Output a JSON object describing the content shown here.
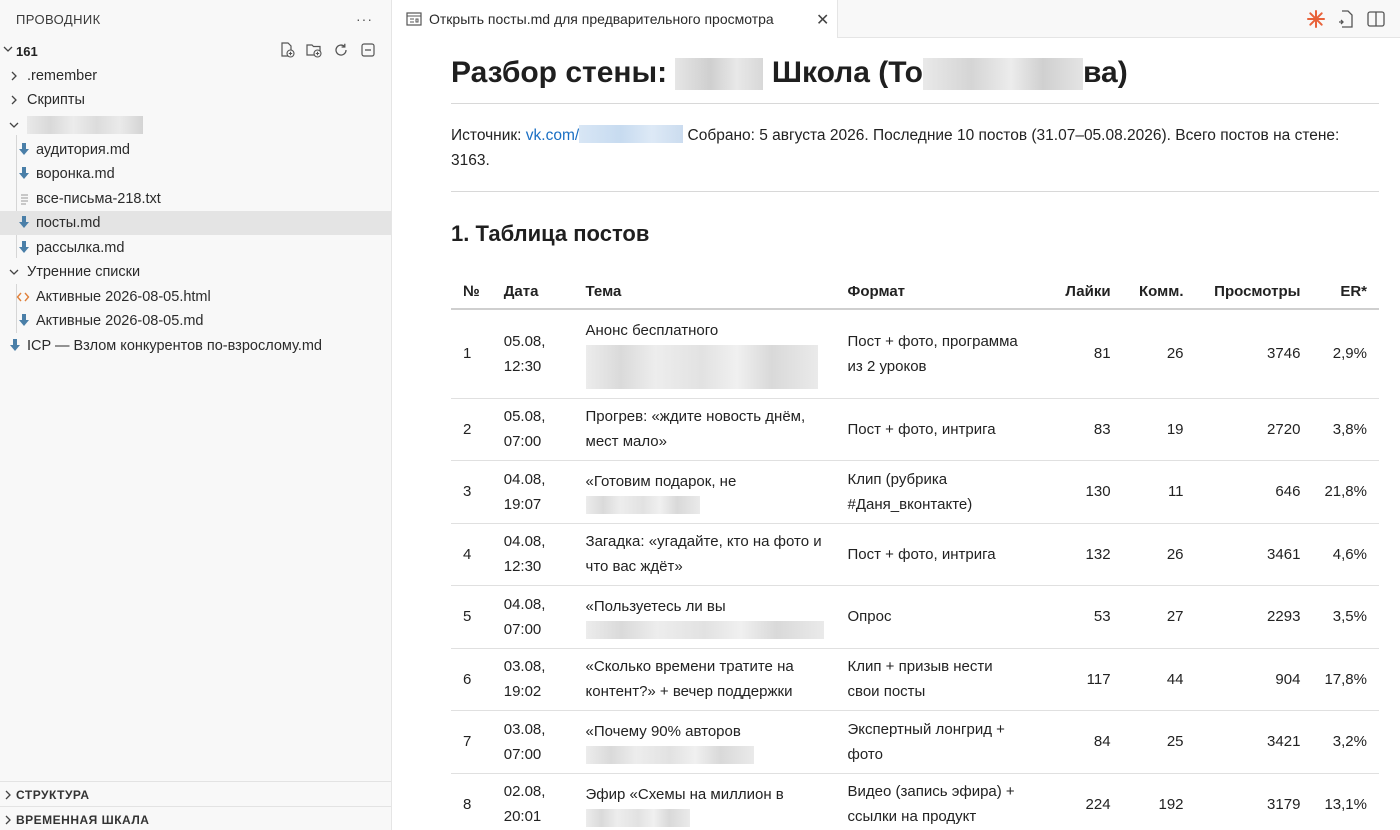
{
  "explorer": {
    "title": "ПРОВОДНИК",
    "more": "···",
    "root_label": "161",
    "items": [
      {
        "label": ".remember",
        "kind": "folder"
      },
      {
        "label": "Скрипты",
        "kind": "folder"
      },
      {
        "label": "",
        "kind": "folder-open"
      },
      {
        "label": "аудитория.md",
        "kind": "md"
      },
      {
        "label": "воронка.md",
        "kind": "md"
      },
      {
        "label": "все-письма-218.txt",
        "kind": "txt"
      },
      {
        "label": "посты.md",
        "kind": "md"
      },
      {
        "label": "рассылка.md",
        "kind": "md"
      },
      {
        "label": "Утренние списки",
        "kind": "folder-open"
      },
      {
        "label": "Активные 2026-08-05.html",
        "kind": "html"
      },
      {
        "label": "Активные 2026-08-05.md",
        "kind": "md"
      },
      {
        "label": "ICP — Взлом конкурентов по-взрослому.md",
        "kind": "md"
      }
    ],
    "structure_label": "СТРУКТУРА",
    "timeline_label": "ВРЕМЕННАЯ ШКАЛА"
  },
  "tab": {
    "label": "Открыть посты.md для предварительного просмотра",
    "close": "✕"
  },
  "accent_color": "#e8623a",
  "doc": {
    "title_part1": "Разбор стены:",
    "title_part2": "Школа (То",
    "title_part3": "ва)",
    "source_prefix": "Источник:",
    "source_link": "vk.com/",
    "source_text": "Собрано: 5 августа 2026. Последние 10 постов (31.07–05.08.2026). Всего постов на стене: 3163.",
    "section_title": "1. Таблица постов"
  },
  "table": {
    "headers": [
      "№",
      "Дата",
      "Тема",
      "Формат",
      "Лайки",
      "Комм.",
      "Просмотры",
      "ER*"
    ],
    "rows": [
      {
        "n": "1",
        "date1": "05.08,",
        "date2": "12:30",
        "topic": "Анонс бесплатного",
        "format": "Пост + фото, программа из 2 уроков",
        "likes": "81",
        "comments": "26",
        "views": "3746",
        "er": "2,9%"
      },
      {
        "n": "2",
        "date1": "05.08,",
        "date2": "07:00",
        "topic": "Прогрев: «ждите новость днём, мест мало»",
        "format": "Пост + фото, интрига",
        "likes": "83",
        "comments": "19",
        "views": "2720",
        "er": "3,8%"
      },
      {
        "n": "3",
        "date1": "04.08,",
        "date2": "19:07",
        "topic": "«Готовим подарок, не",
        "format": "Клип (рубрика #Даня_вконтакте)",
        "likes": "130",
        "comments": "11",
        "views": "646",
        "er": "21,8%"
      },
      {
        "n": "4",
        "date1": "04.08,",
        "date2": "12:30",
        "topic": "Загадка: «угадайте, кто на фото и что вас ждёт»",
        "format": "Пост + фото, интрига",
        "likes": "132",
        "comments": "26",
        "views": "3461",
        "er": "4,6%"
      },
      {
        "n": "5",
        "date1": "04.08,",
        "date2": "07:00",
        "topic": "«Пользуетесь ли вы",
        "format": "Опрос",
        "likes": "53",
        "comments": "27",
        "views": "2293",
        "er": "3,5%"
      },
      {
        "n": "6",
        "date1": "03.08,",
        "date2": "19:02",
        "topic": "«Сколько времени тратите на контент?» + вечер поддержки",
        "format": "Клип + призыв нести свои посты",
        "likes": "117",
        "comments": "44",
        "views": "904",
        "er": "17,8%"
      },
      {
        "n": "7",
        "date1": "03.08,",
        "date2": "07:00",
        "topic": "«Почему 90% авторов",
        "format": "Экспертный лонгрид + фото",
        "likes": "84",
        "comments": "25",
        "views": "3421",
        "er": "3,2%"
      },
      {
        "n": "8",
        "date1": "02.08,",
        "date2": "20:01",
        "topic": "Эфир «Схемы на миллион в",
        "format": "Видео (запись эфира) + ссылки на продукт",
        "likes": "224",
        "comments": "192",
        "views": "3179",
        "er": "13,1%"
      }
    ]
  }
}
